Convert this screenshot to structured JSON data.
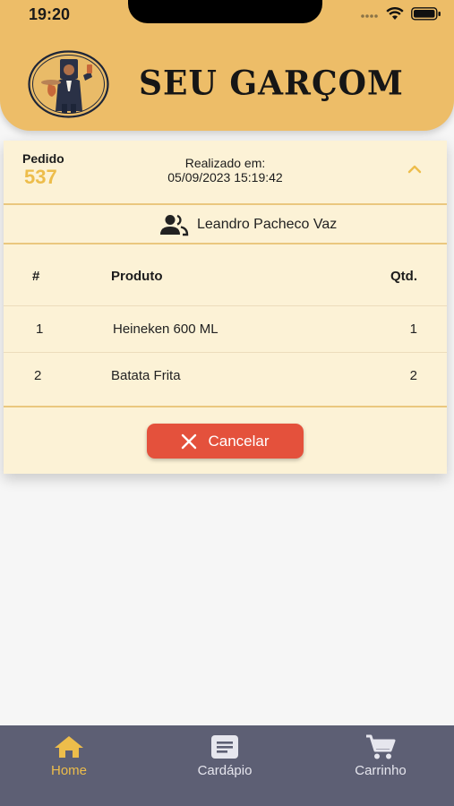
{
  "status_bar": {
    "time": "19:20"
  },
  "header": {
    "title": "SEU GARÇOM",
    "logo": "waiter-logo-icon"
  },
  "order": {
    "pedido_label": "Pedido",
    "pedido_number": "537",
    "realizado_label": "Realizado em:",
    "realizado_date": "05/09/2023 15:19:42",
    "customer_name": "Leandro Pacheco Vaz",
    "table": {
      "headers": [
        "#",
        "Produto",
        "Qtd."
      ],
      "rows": [
        {
          "idx": "1",
          "product": "Heineken 600 ML",
          "qty": "1"
        },
        {
          "idx": "2",
          "product": "Batata Frita",
          "qty": "2"
        }
      ]
    },
    "cancel_label": "Cancelar"
  },
  "nav": {
    "items": [
      {
        "label": "Home",
        "icon": "home-icon",
        "active": true
      },
      {
        "label": "Cardápio",
        "icon": "menu-list-icon",
        "active": false
      },
      {
        "label": "Carrinho",
        "icon": "cart-icon",
        "active": false
      }
    ]
  },
  "colors": {
    "header_bg": "#edbd68",
    "accent": "#edbd4b",
    "card_bg": "#fcf2d6",
    "cancel_bg": "#e4513c",
    "nav_bg": "#5d5f74"
  }
}
